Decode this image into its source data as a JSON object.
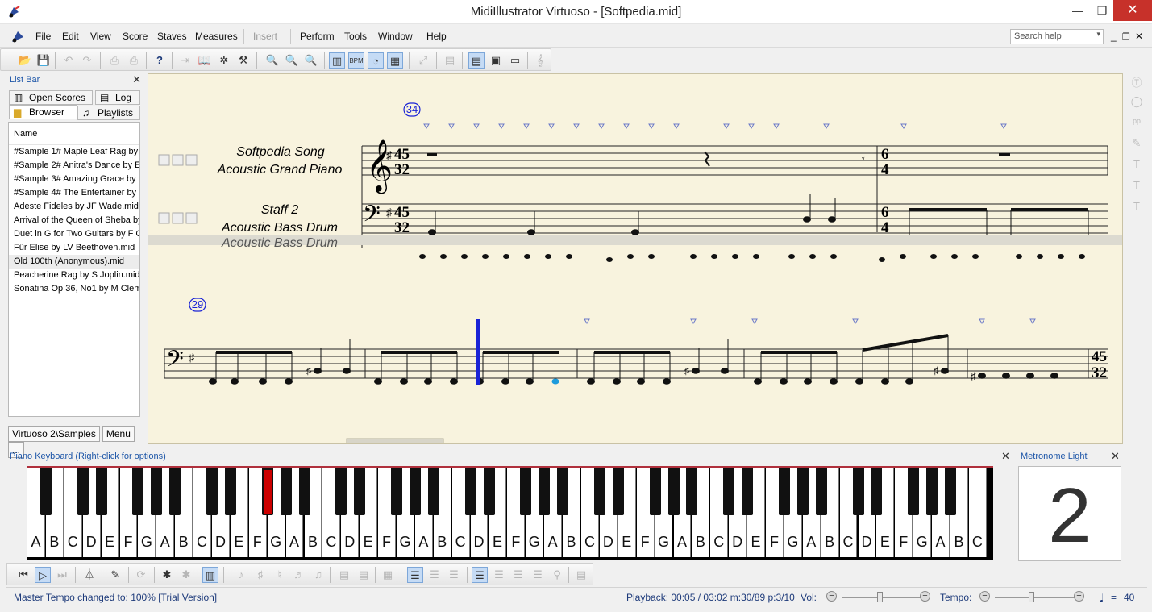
{
  "window": {
    "title": "MidiIllustrator Virtuoso - [Softpedia.mid]",
    "minimize": "—",
    "restore": "❐",
    "close": "✕"
  },
  "menu": {
    "items": [
      "File",
      "Edit",
      "View",
      "Score",
      "Staves",
      "Measures",
      "Insert",
      "Perform",
      "Tools",
      "Window",
      "Help"
    ],
    "disabled": [
      "Insert"
    ],
    "search_placeholder": "Search help"
  },
  "list_bar": {
    "title": "List Bar",
    "tabs": [
      "Open Scores",
      "Log",
      "Browser",
      "Playlists"
    ],
    "active_tab": "Browser",
    "column": "Name",
    "files": [
      "#Sample 1# Maple Leaf Rag by",
      "#Sample 2# Anitra's Dance by E",
      "#Sample 3# Amazing Grace by J",
      "#Sample 4# The Entertainer by S",
      "Adeste Fideles by JF Wade.mid",
      "Arrival of the Queen of Sheba by",
      "Duet in G for Two Guitars by F C",
      "Für Elise by LV Beethoven.mid",
      "Old 100th (Anonymous).mid",
      "Peacherine Rag by S Joplin.mid",
      "Sonatina Op 36, No1 by M Cleme"
    ],
    "selected_file": "Old 100th (Anonymous).mid",
    "footer": [
      "Virtuoso 2\\Samples",
      "Menu",
      "..."
    ]
  },
  "score": {
    "system1": {
      "measure_number": "34",
      "staff1_name": "Softpedia Song",
      "staff1_instrument": "Acoustic Grand Piano",
      "staff2_name": "Staff 2",
      "staff2_instrument": "Acoustic Bass Drum",
      "time_sig_1_top": "45",
      "time_sig_1_bottom": "32",
      "time_sig_2_top": "6",
      "time_sig_2_bottom": "4"
    },
    "system2": {
      "measure_number": "29",
      "time_sig_top": "45",
      "time_sig_bottom": "32"
    }
  },
  "piano_panel": {
    "title": "Piano Keyboard (Right-click for options)",
    "white_keys": [
      "A",
      "B",
      "C",
      "D",
      "E",
      "F",
      "G",
      "A",
      "B",
      "C",
      "D",
      "E",
      "F",
      "G",
      "A",
      "B",
      "C",
      "D",
      "E",
      "F",
      "G",
      "A",
      "B",
      "C",
      "D",
      "E",
      "F",
      "G",
      "A",
      "B",
      "C",
      "D",
      "E",
      "F",
      "G",
      "A",
      "B",
      "C",
      "D",
      "E",
      "F",
      "G",
      "A",
      "B",
      "C",
      "D",
      "E",
      "F",
      "G",
      "A",
      "B",
      "C"
    ],
    "highlighted_black_key": "F#"
  },
  "metronome": {
    "title": "Metronome Light",
    "beat": "2"
  },
  "status": {
    "message": "Master Tempo changed to: 100%  [Trial Version]",
    "playback": "Playback: 00:05 / 03:02  m:30/89  p:3/10",
    "vol_label": "Vol:",
    "tempo_label": "Tempo:",
    "tempo_value": "40",
    "note_eq": "="
  },
  "colors": {
    "accent": "#1d56a8",
    "close": "#c7312a",
    "paper": "#f8f3de",
    "playhead": "#1a23d6",
    "highlight_key": "#cc0000"
  }
}
